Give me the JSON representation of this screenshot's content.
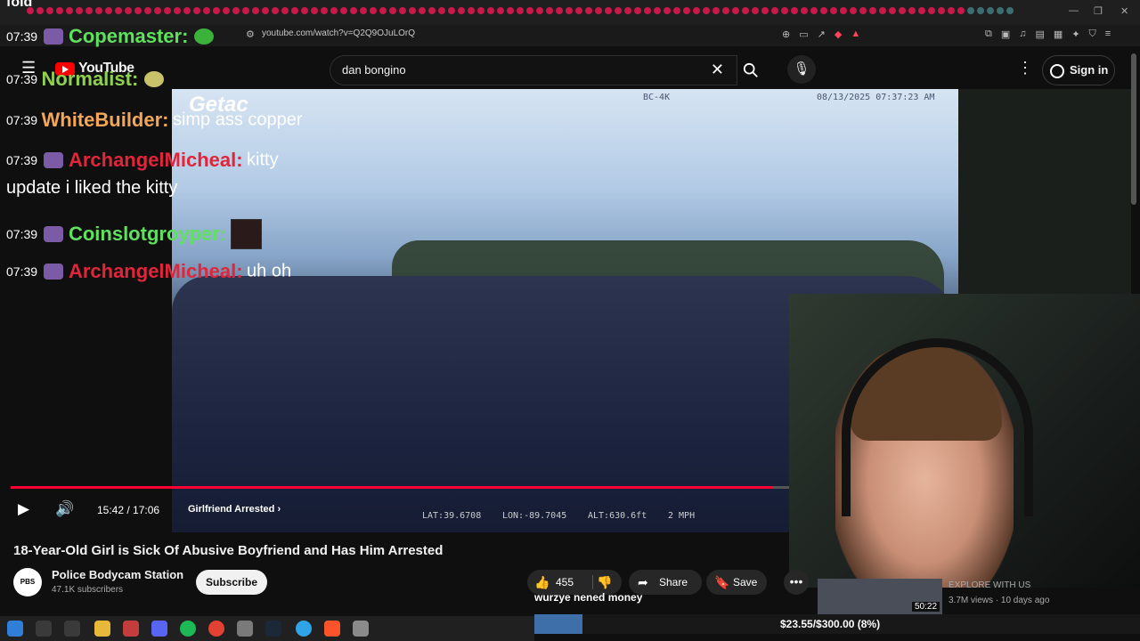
{
  "browser": {
    "url": "youtube.com/watch?v=Q2Q9OJuLOrQ",
    "win_min": "—",
    "win_max": "❐",
    "win_close": "✕"
  },
  "header": {
    "logo_text": "YouTube",
    "search_value": "dan bongino",
    "sign_in": "Sign in"
  },
  "video": {
    "brand": "Getac",
    "cam_id": "BC-4K",
    "timestamp": "08/13/2025 07:37:23 AM",
    "lat": "LAT:39.6708",
    "lon": "LON:-89.7045",
    "alt": "ALT:630.6ft",
    "speed": "2 MPH",
    "time": "15:42 / 17:06",
    "chapter": "Girlfriend Arrested",
    "progress": 0.919
  },
  "chat": {
    "heading": "fold",
    "rows": [
      {
        "time": "07:39",
        "user": "Copemaster:",
        "color": "#5fe05f",
        "msg": ""
      },
      {
        "time": "07:39",
        "user": "Normalist:",
        "color": "#8fd14f",
        "msg": ""
      },
      {
        "time": "07:39",
        "user": "WhiteBuilder:",
        "color": "#f2a65a",
        "msg": "simp ass copper"
      },
      {
        "time": "07:39",
        "user": "ArchangelMicheal:",
        "color": "#e0263a",
        "msg": "kitty"
      },
      {
        "time": "",
        "user": "",
        "color": "#ffffff",
        "msg": "update i liked the kitty"
      },
      {
        "time": "07:39",
        "user": "Coinslotgroyper:",
        "color": "#5fe05f",
        "msg": ""
      },
      {
        "time": "07:39",
        "user": "ArchangelMicheal:",
        "color": "#e0263a",
        "msg": "uh oh"
      }
    ]
  },
  "info": {
    "title": "18-Year-Old Girl is Sick Of Abusive Boyfriend and Has Him Arrested",
    "channel": "Police Bodycam Station",
    "avatar": "PBS",
    "subs": "47.1K subscribers",
    "subscribe": "Subscribe",
    "likes": "455",
    "share": "Share",
    "save": "Save"
  },
  "caption": "wurzye nened money",
  "recommended": {
    "title": "EXPLORE WITH US",
    "duration": "50:22",
    "meta": "3.7M views · 10 days ago"
  },
  "donation": {
    "text": "$23.55/$300.00 (8%)",
    "fraction": 0.08
  }
}
